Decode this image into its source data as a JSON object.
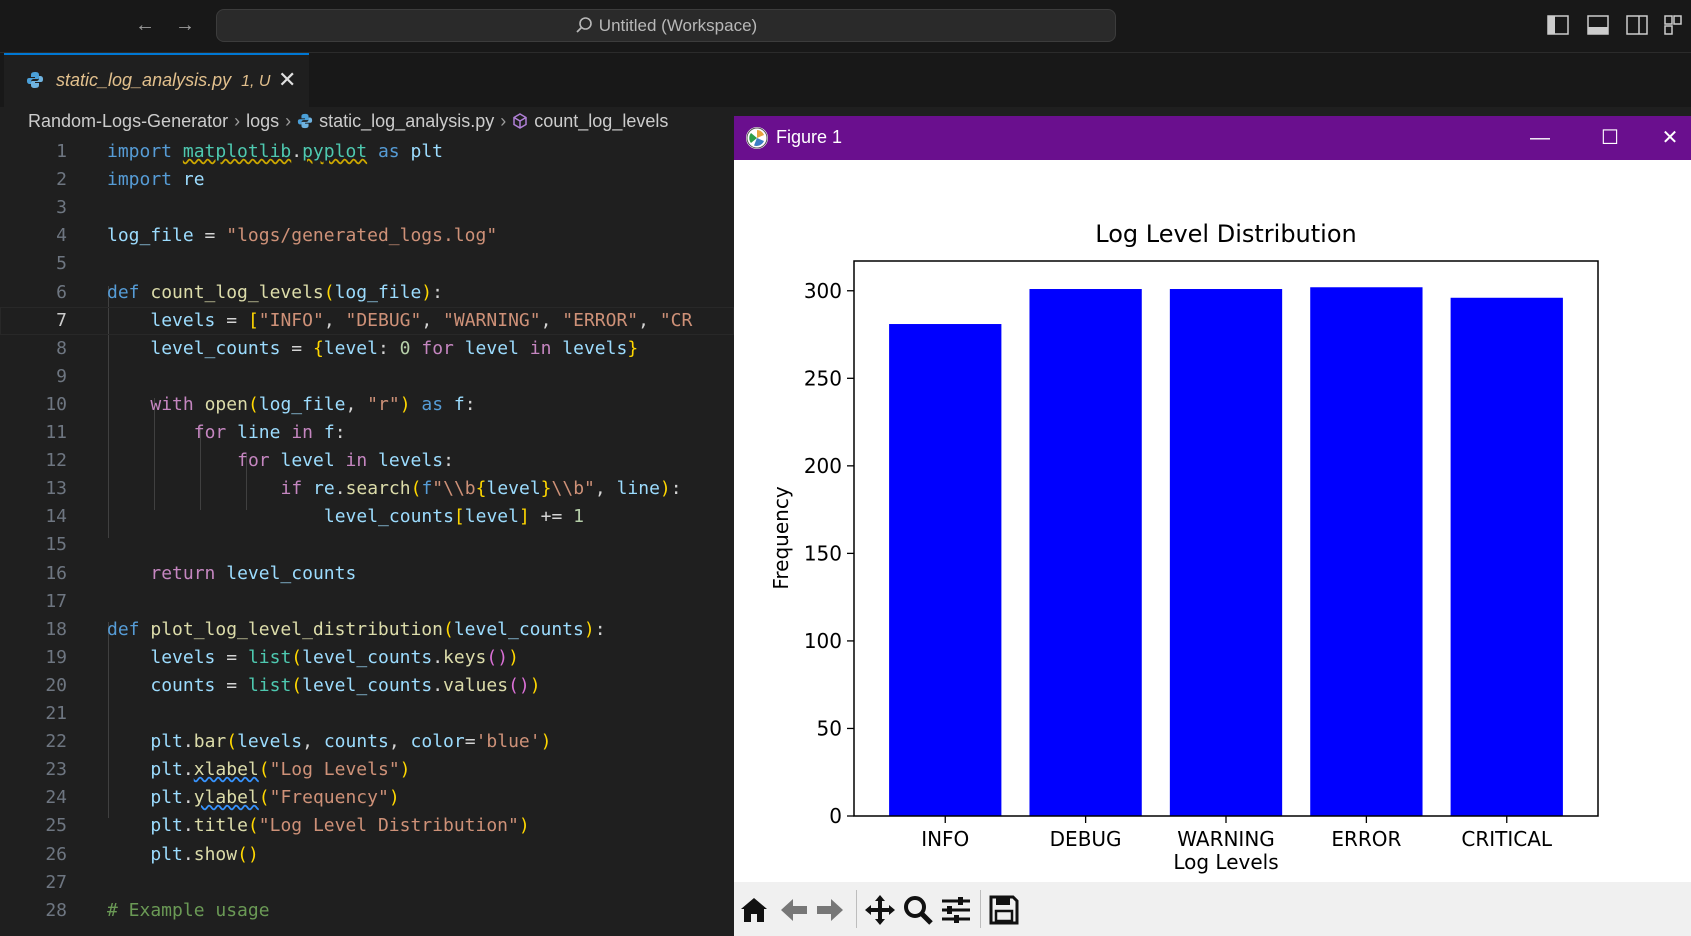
{
  "titlebar": {
    "search_label": "Untitled (Workspace)",
    "icons": [
      "back-arrow-icon",
      "forward-arrow-icon",
      "search-icon",
      "toggle-primary-sidebar-icon",
      "toggle-panel-icon",
      "toggle-secondary-sidebar-icon",
      "customize-layout-icon"
    ]
  },
  "tab": {
    "filename": "static_log_analysis.py",
    "status": "1, U"
  },
  "breadcrumb": {
    "items": [
      "Random-Logs-Generator",
      "logs",
      "static_log_analysis.py",
      "count_log_levels"
    ]
  },
  "editor": {
    "line_numbers": [
      "1",
      "2",
      "3",
      "4",
      "5",
      "6",
      "7",
      "8",
      "9",
      "10",
      "11",
      "12",
      "13",
      "14",
      "15",
      "16",
      "17",
      "18",
      "19",
      "20",
      "21",
      "22",
      "23",
      "24",
      "25",
      "26",
      "27",
      "28"
    ],
    "active_line": "7",
    "lines": [
      "import matplotlib.pyplot as plt",
      "import re",
      "",
      "log_file = \"logs/generated_logs.log\"",
      "",
      "def count_log_levels(log_file):",
      "    levels = [\"INFO\", \"DEBUG\", \"WARNING\", \"ERROR\", \"CR",
      "    level_counts = {level: 0 for level in levels}",
      "",
      "    with open(log_file, \"r\") as f:",
      "        for line in f:",
      "            for level in levels:",
      "                if re.search(f\"\\\\b{level}\\\\b\", line):",
      "                    level_counts[level] += 1",
      "",
      "    return level_counts",
      "",
      "def plot_log_level_distribution(level_counts):",
      "    levels = list(level_counts.keys())",
      "    counts = list(level_counts.values())",
      "",
      "    plt.bar(levels, counts, color='blue')",
      "    plt.xlabel(\"Log Levels\")",
      "    plt.ylabel(\"Frequency\")",
      "    plt.title(\"Log Level Distribution\")",
      "    plt.show()",
      "",
      "# Example usage"
    ]
  },
  "figure": {
    "window_title": "Figure 1",
    "controls": [
      "minimize-icon",
      "maximize-icon",
      "close-icon"
    ],
    "toolbar": [
      "home-icon",
      "back-icon",
      "forward-icon",
      "pan-icon",
      "zoom-icon",
      "configure-subplots-icon",
      "save-icon"
    ]
  },
  "chart_data": {
    "type": "bar",
    "title": "Log Level Distribution",
    "xlabel": "Log Levels",
    "ylabel": "Frequency",
    "categories": [
      "INFO",
      "DEBUG",
      "WARNING",
      "ERROR",
      "CRITICAL"
    ],
    "values": [
      281,
      301,
      301,
      302,
      296
    ],
    "ylim": [
      0,
      317
    ],
    "yticks": [
      0,
      50,
      100,
      150,
      200,
      250,
      300
    ],
    "color": "#0000ff",
    "grid": false
  }
}
